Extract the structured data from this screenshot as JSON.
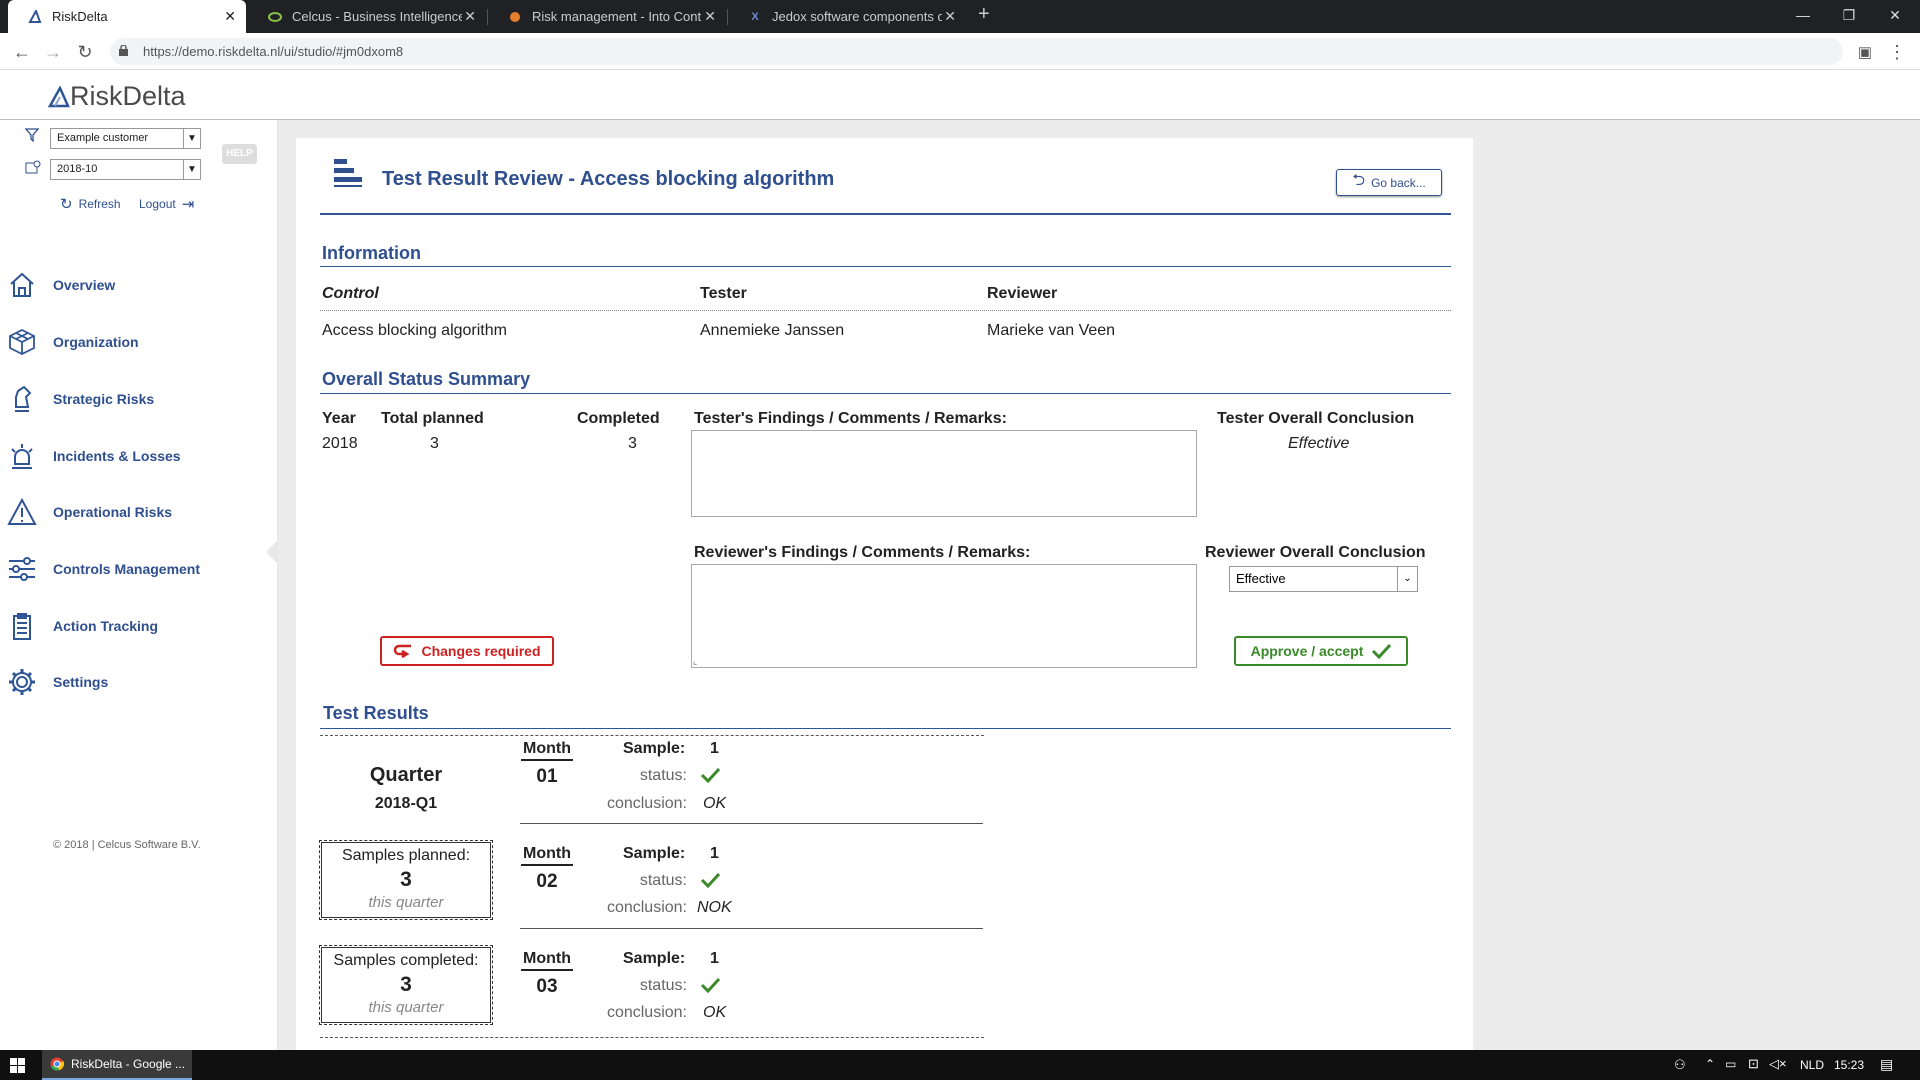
{
  "browser": {
    "tabs": [
      {
        "title": "RiskDelta",
        "active": true
      },
      {
        "title": "Celcus - Business Intelligence en",
        "active": false
      },
      {
        "title": "Risk management - Into Control",
        "active": false
      },
      {
        "title": "Jedox software components driv",
        "active": false
      }
    ],
    "url": "https://demo.riskdelta.nl/ui/studio/#jm0dxom8"
  },
  "app": {
    "logo_text": "RiskDelta",
    "customer_select": "Example customer",
    "period_select": "2018-10",
    "help_badge": "HELP",
    "refresh_label": "Refresh",
    "logout_label": "Logout",
    "nav": [
      {
        "label": "Overview",
        "icon": "home-icon"
      },
      {
        "label": "Organization",
        "icon": "cube-icon"
      },
      {
        "label": "Strategic Risks",
        "icon": "chess-knight-icon"
      },
      {
        "label": "Incidents & Losses",
        "icon": "alarm-light-icon"
      },
      {
        "label": "Operational Risks",
        "icon": "warning-triangle-icon"
      },
      {
        "label": "Controls Management",
        "icon": "sliders-icon"
      },
      {
        "label": "Action Tracking",
        "icon": "clipboard-icon"
      },
      {
        "label": "Settings",
        "icon": "gear-icon"
      }
    ],
    "copyright": "© 2018 | Celcus Software B.V."
  },
  "page": {
    "title": "Test Result Review - Access blocking algorithm",
    "go_back": "Go back...",
    "info_heading": "Information",
    "info_labels": {
      "control": "Control",
      "tester": "Tester",
      "reviewer": "Reviewer"
    },
    "info_values": {
      "control": "Access blocking algorithm",
      "tester": "Annemieke Janssen",
      "reviewer": "Marieke van Veen"
    },
    "summary_heading": "Overall Status Summary",
    "summary_labels": {
      "year": "Year",
      "total_planned": "Total planned",
      "completed": "Completed"
    },
    "summary_values": {
      "year": "2018",
      "total_planned": "3",
      "completed": "3"
    },
    "tester_findings_label": "Tester's Findings / Comments / Remarks:",
    "tester_conclusion_label": "Tester Overall Conclusion",
    "tester_conclusion_value": "Effective",
    "reviewer_findings_label": "Reviewer's Findings / Comments / Remarks:",
    "reviewer_conclusion_label": "Reviewer Overall Conclusion",
    "reviewer_conclusion_value": "Effective",
    "changes_button": "Changes required",
    "approve_button": "Approve / accept",
    "results_heading": "Test Results",
    "quarter_label": "Quarter",
    "quarter_value": "2018-Q1",
    "samples_planned_label": "Samples planned:",
    "samples_planned_value": "3",
    "samples_completed_label": "Samples completed:",
    "samples_completed_value": "3",
    "this_quarter": "this quarter",
    "month_label": "Month",
    "sample_label": "Sample:",
    "status_label": "status:",
    "conclusion_label": "conclusion:",
    "months": [
      {
        "month": "01",
        "sample": "1",
        "conclusion": "OK"
      },
      {
        "month": "02",
        "sample": "1",
        "conclusion": "NOK"
      },
      {
        "month": "03",
        "sample": "1",
        "conclusion": "OK"
      }
    ],
    "accent_color": "#2f4f8f"
  },
  "taskbar": {
    "app_label": "RiskDelta - Google ...",
    "language": "NLD",
    "time": "15:23"
  }
}
